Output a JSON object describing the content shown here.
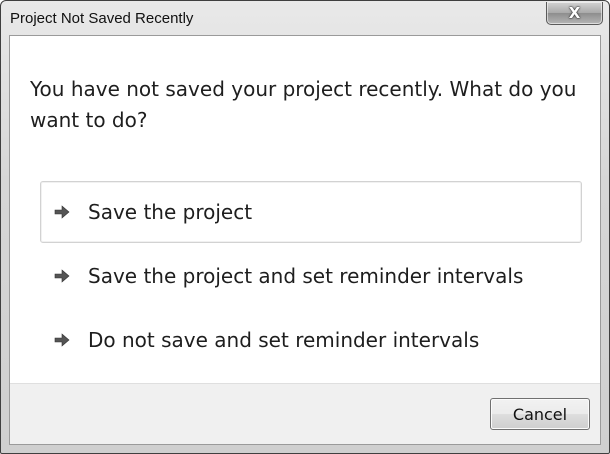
{
  "window": {
    "title": "Project Not Saved Recently",
    "close_label": "X"
  },
  "dialog": {
    "instruction": "You have not saved your project recently.  What do you want to do?",
    "commands": [
      {
        "label": "Save the project",
        "icon": "arrow-right-icon",
        "selected": true
      },
      {
        "label": "Save the project and set reminder intervals",
        "icon": "arrow-right-icon",
        "selected": false
      },
      {
        "label": "Do not save and set reminder intervals",
        "icon": "arrow-right-icon",
        "selected": false
      }
    ]
  },
  "footer": {
    "cancel_label": "Cancel"
  },
  "colors": {
    "titlebar": "#d6d6d6",
    "content_bg": "#ffffff",
    "footer_bg": "#f0f0f0",
    "text": "#1e1e1e"
  }
}
